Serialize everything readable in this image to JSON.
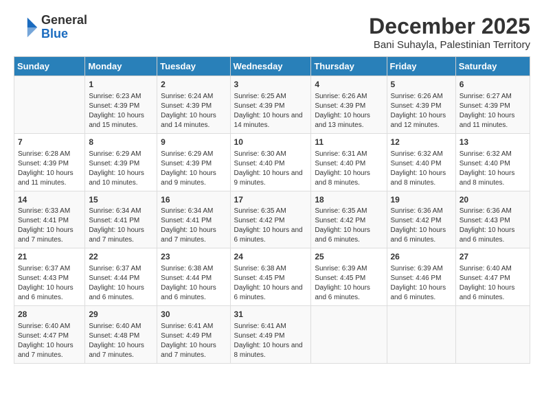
{
  "logo": {
    "general": "General",
    "blue": "Blue"
  },
  "title": "December 2025",
  "subtitle": "Bani Suhayla, Palestinian Territory",
  "headers": [
    "Sunday",
    "Monday",
    "Tuesday",
    "Wednesday",
    "Thursday",
    "Friday",
    "Saturday"
  ],
  "weeks": [
    [
      {
        "day": "",
        "info": ""
      },
      {
        "day": "1",
        "info": "Sunrise: 6:23 AM\nSunset: 4:39 PM\nDaylight: 10 hours and 15 minutes."
      },
      {
        "day": "2",
        "info": "Sunrise: 6:24 AM\nSunset: 4:39 PM\nDaylight: 10 hours and 14 minutes."
      },
      {
        "day": "3",
        "info": "Sunrise: 6:25 AM\nSunset: 4:39 PM\nDaylight: 10 hours and 14 minutes."
      },
      {
        "day": "4",
        "info": "Sunrise: 6:26 AM\nSunset: 4:39 PM\nDaylight: 10 hours and 13 minutes."
      },
      {
        "day": "5",
        "info": "Sunrise: 6:26 AM\nSunset: 4:39 PM\nDaylight: 10 hours and 12 minutes."
      },
      {
        "day": "6",
        "info": "Sunrise: 6:27 AM\nSunset: 4:39 PM\nDaylight: 10 hours and 11 minutes."
      }
    ],
    [
      {
        "day": "7",
        "info": "Sunrise: 6:28 AM\nSunset: 4:39 PM\nDaylight: 10 hours and 11 minutes."
      },
      {
        "day": "8",
        "info": "Sunrise: 6:29 AM\nSunset: 4:39 PM\nDaylight: 10 hours and 10 minutes."
      },
      {
        "day": "9",
        "info": "Sunrise: 6:29 AM\nSunset: 4:39 PM\nDaylight: 10 hours and 9 minutes."
      },
      {
        "day": "10",
        "info": "Sunrise: 6:30 AM\nSunset: 4:40 PM\nDaylight: 10 hours and 9 minutes."
      },
      {
        "day": "11",
        "info": "Sunrise: 6:31 AM\nSunset: 4:40 PM\nDaylight: 10 hours and 8 minutes."
      },
      {
        "day": "12",
        "info": "Sunrise: 6:32 AM\nSunset: 4:40 PM\nDaylight: 10 hours and 8 minutes."
      },
      {
        "day": "13",
        "info": "Sunrise: 6:32 AM\nSunset: 4:40 PM\nDaylight: 10 hours and 8 minutes."
      }
    ],
    [
      {
        "day": "14",
        "info": "Sunrise: 6:33 AM\nSunset: 4:41 PM\nDaylight: 10 hours and 7 minutes."
      },
      {
        "day": "15",
        "info": "Sunrise: 6:34 AM\nSunset: 4:41 PM\nDaylight: 10 hours and 7 minutes."
      },
      {
        "day": "16",
        "info": "Sunrise: 6:34 AM\nSunset: 4:41 PM\nDaylight: 10 hours and 7 minutes."
      },
      {
        "day": "17",
        "info": "Sunrise: 6:35 AM\nSunset: 4:42 PM\nDaylight: 10 hours and 6 minutes."
      },
      {
        "day": "18",
        "info": "Sunrise: 6:35 AM\nSunset: 4:42 PM\nDaylight: 10 hours and 6 minutes."
      },
      {
        "day": "19",
        "info": "Sunrise: 6:36 AM\nSunset: 4:42 PM\nDaylight: 10 hours and 6 minutes."
      },
      {
        "day": "20",
        "info": "Sunrise: 6:36 AM\nSunset: 4:43 PM\nDaylight: 10 hours and 6 minutes."
      }
    ],
    [
      {
        "day": "21",
        "info": "Sunrise: 6:37 AM\nSunset: 4:43 PM\nDaylight: 10 hours and 6 minutes."
      },
      {
        "day": "22",
        "info": "Sunrise: 6:37 AM\nSunset: 4:44 PM\nDaylight: 10 hours and 6 minutes."
      },
      {
        "day": "23",
        "info": "Sunrise: 6:38 AM\nSunset: 4:44 PM\nDaylight: 10 hours and 6 minutes."
      },
      {
        "day": "24",
        "info": "Sunrise: 6:38 AM\nSunset: 4:45 PM\nDaylight: 10 hours and 6 minutes."
      },
      {
        "day": "25",
        "info": "Sunrise: 6:39 AM\nSunset: 4:45 PM\nDaylight: 10 hours and 6 minutes."
      },
      {
        "day": "26",
        "info": "Sunrise: 6:39 AM\nSunset: 4:46 PM\nDaylight: 10 hours and 6 minutes."
      },
      {
        "day": "27",
        "info": "Sunrise: 6:40 AM\nSunset: 4:47 PM\nDaylight: 10 hours and 6 minutes."
      }
    ],
    [
      {
        "day": "28",
        "info": "Sunrise: 6:40 AM\nSunset: 4:47 PM\nDaylight: 10 hours and 7 minutes."
      },
      {
        "day": "29",
        "info": "Sunrise: 6:40 AM\nSunset: 4:48 PM\nDaylight: 10 hours and 7 minutes."
      },
      {
        "day": "30",
        "info": "Sunrise: 6:41 AM\nSunset: 4:49 PM\nDaylight: 10 hours and 7 minutes."
      },
      {
        "day": "31",
        "info": "Sunrise: 6:41 AM\nSunset: 4:49 PM\nDaylight: 10 hours and 8 minutes."
      },
      {
        "day": "",
        "info": ""
      },
      {
        "day": "",
        "info": ""
      },
      {
        "day": "",
        "info": ""
      }
    ]
  ]
}
